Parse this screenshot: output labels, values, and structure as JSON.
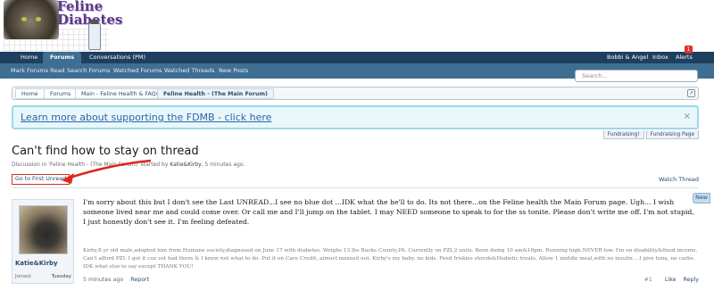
{
  "site": {
    "logo_line1": "Feline",
    "logo_line2": "Diabetes"
  },
  "nav": {
    "tabs": [
      "Home",
      "Forums",
      "Conversations (PM)"
    ],
    "active": "Forums",
    "right": [
      "Bobbi & Angel",
      "Inbox",
      "Alerts"
    ],
    "alerts_count": "1"
  },
  "subnav": {
    "links": [
      "Mark Forums Read",
      "Search Forums",
      "Watched Forums",
      "Watched Threads",
      "New Posts"
    ],
    "search_placeholder": "Search..."
  },
  "breadcrumb": [
    "Home",
    "Forums",
    "Main - Feline Health & FAQs",
    "Feline Health - (The Main Forum)"
  ],
  "notice": {
    "text": "Learn more about supporting the FDMB - click here",
    "close": "×"
  },
  "fund_tabs": [
    "Fundraising!",
    "Fundraising Page"
  ],
  "thread": {
    "title": "Can't find how to stay on thread",
    "meta_prefix": "Discussion in 'Feline Health - (The Main Forum)' started by",
    "author": "Katie&Kirby",
    "time": "5 minutes ago",
    "first_unread": "Go to First Unread",
    "watch": "Watch Thread",
    "new_tab": "New"
  },
  "post": {
    "username": "Katie&Kirby",
    "joined_label": "Joined:",
    "joined_value": "Tuesday",
    "body": "I'm sorry about this but I don't see the Last UNREAD...I see no blue dot ...IDK what the he'll to do. Its not there...on the Feline health the Main Forum page. Ugh... I wish someone lived near me and could come over. Or call me and I'll jump on the tablet. I may NEED someone to speak to for the ss tonite. Please don't write me off. I'm not stupid, I just honestly don't see it. I'm feeling defeated.",
    "signature": "Kirby,8 yr old male,adopted him from Humane society,diagnosed on June 17 with diabetes. Weighs 13 lbs Bucks County,PA. Currently on PZI,2 units. Been doing 10 am&10pm. Running high.NEVER low. I'm on disability&fixed income. Can't afford PZI. I got it cuz vet had there & I knew not what to do. Put it on Care Credit, almost maxxed out. Kirby's my baby. no kids. Feed friskies shreds&Diabetic treats. Allow 1 middle meal,with no insulin ...I give tuna, no carbs. IDK what else to say except THANK YOU!",
    "time": "5 minutes ago",
    "report": "Report",
    "number": "#1",
    "like": "Like",
    "reply": "Reply"
  },
  "colors": {
    "navbar": "#1f3f5f",
    "subnav": "#3f6e93",
    "notice_bg": "#e9f7fb",
    "highlight_red": "#d6321c"
  }
}
